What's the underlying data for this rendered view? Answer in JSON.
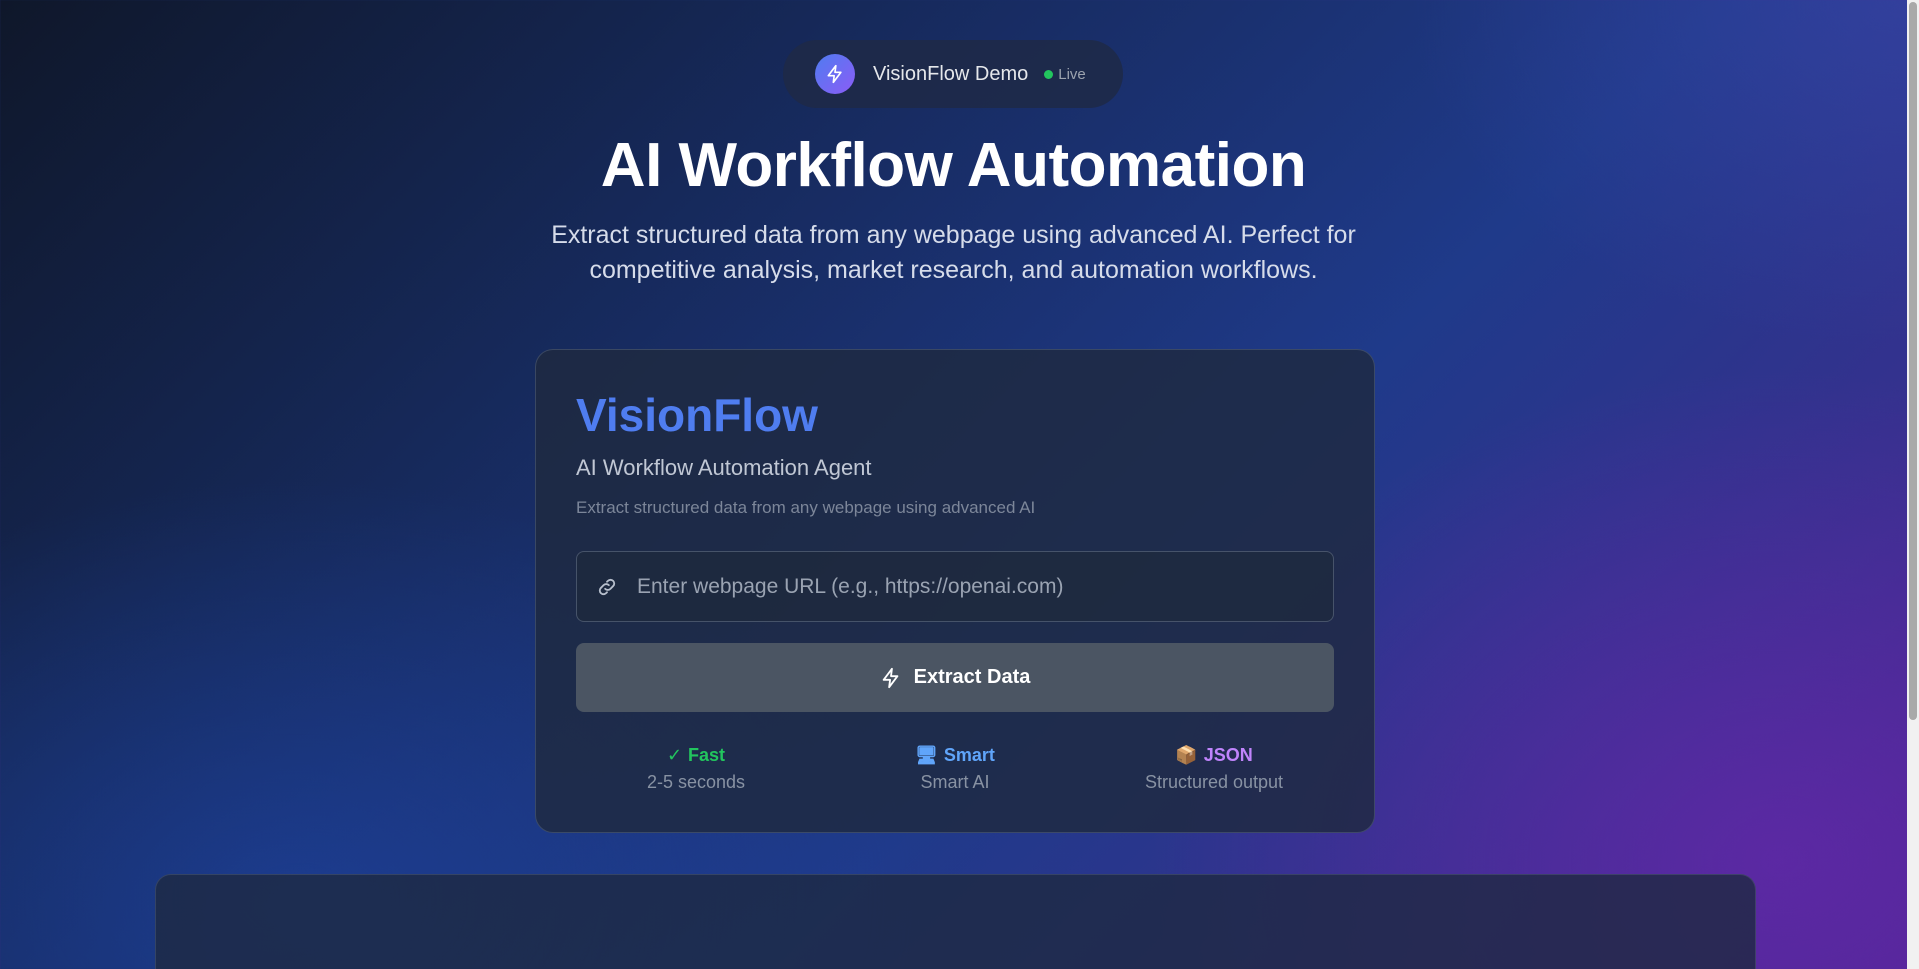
{
  "header": {
    "title": "VisionFlow Demo",
    "status": "Live",
    "status_color": "#22c55e",
    "logo_icon": "lightning-icon"
  },
  "hero": {
    "title": "AI Workflow Automation",
    "subtitle": "Extract structured data from any webpage using advanced AI. Perfect for competitive analysis, market research, and automation workflows."
  },
  "card": {
    "brand": "VisionFlow",
    "brand_color": "#4f7df0",
    "tagline": "AI Workflow Automation Agent",
    "description": "Extract structured data from any webpage using advanced AI",
    "url_input": {
      "placeholder": "Enter webpage URL (e.g., https://openai.com)",
      "value": "",
      "icon": "link-icon"
    },
    "extract_button": {
      "label": "Extract Data",
      "icon": "lightning-icon"
    },
    "features": [
      {
        "icon": "check-icon",
        "glyph": "✓",
        "title": "Fast",
        "subtitle": "2-5 seconds",
        "color": "#22c55e"
      },
      {
        "icon": "computer-icon",
        "glyph": "🖥",
        "title": "Smart",
        "subtitle": "Smart AI",
        "color": "#60a5fa"
      },
      {
        "icon": "package-icon",
        "glyph": "📦",
        "title": "JSON",
        "subtitle": "Structured output",
        "color": "#c084fc"
      }
    ]
  }
}
